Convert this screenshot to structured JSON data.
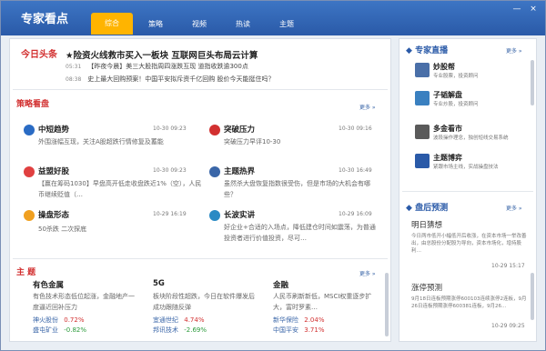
{
  "app": {
    "title": "专家看点",
    "window_buttons": [
      "—",
      "×"
    ]
  },
  "tabs": [
    {
      "label": "综合",
      "active": true
    },
    {
      "label": "策略",
      "active": false
    },
    {
      "label": "视频",
      "active": false
    },
    {
      "label": "热读",
      "active": false
    },
    {
      "label": "主题",
      "active": false
    }
  ],
  "today": {
    "label": "今日头条",
    "headline": "★险资火线救市买入一板块 互联网巨头布局云计算",
    "items": [
      {
        "time": "05:31",
        "text": "【昨夜今晨】美三大股指周四涨跌互现 道指收跌逾300点"
      },
      {
        "time": "08:38",
        "text": "史上最大回购预案！中国平安拟斥资千亿回购 股价今天能挺住吗？"
      }
    ]
  },
  "strategy": {
    "label": "策略看盘",
    "more": "更多 »",
    "items": [
      {
        "title": "中短趋势",
        "date": "10-30",
        "time": "09:23",
        "desc": "外围涨幅互现，关注A股超跌行情修复及蓄能",
        "icon_color": "#2a6bc4"
      },
      {
        "title": "突破压力",
        "date": "10-30",
        "time": "09:16",
        "desc": "突破压力早评10-30",
        "icon_color": "#d23030"
      },
      {
        "title": "益盟好股",
        "date": "10-30",
        "time": "09:23",
        "desc": "【赢在筹码1030】早盘高开低走收盘跌近1%（空），人民币继续贬值（…",
        "icon_color": "#e04040"
      },
      {
        "title": "主题热界",
        "date": "10-30",
        "time": "16:49",
        "desc": "虽然杀大盘恢复指数很受伤，但是市场的大机会有哪些？",
        "icon_color": "#3a66a8"
      },
      {
        "title": "操盘形态",
        "date": "10-29",
        "time": "16:19",
        "desc": "50杀跌 二次探底",
        "icon_color": "#f0a020"
      },
      {
        "title": "长波实讲",
        "date": "10-29",
        "time": "16:09",
        "desc": "好企业+合适的入场点，降低建仓时间如震荡，为普通投资者进行价值投资，尽可…",
        "icon_color": "#2a8ac4"
      }
    ]
  },
  "topics": {
    "label": "主 题",
    "more": "更多 »",
    "columns": [
      {
        "title": "有色金属",
        "desc": "有色技术形态低位起涨，金融地产一度逼近回补压力",
        "stocks": [
          {
            "name": "神火股份",
            "change": "0.72%",
            "dir": "up"
          },
          {
            "name": "盛屯矿业",
            "change": "-0.82%",
            "dir": "down"
          }
        ]
      },
      {
        "title": "5G",
        "desc": "板块阶段性超跌，今日在软件爆发后成功跟随反弹",
        "stocks": [
          {
            "name": "宜通世纪",
            "change": "4.74%",
            "dir": "up"
          },
          {
            "name": "邦讯技术",
            "change": "-2.69%",
            "dir": "down"
          }
        ]
      },
      {
        "title": "金融",
        "desc": "人民币刷新新低，MSCI权重逐步扩大，富时罗素…",
        "stocks": [
          {
            "name": "新华保险",
            "change": "2.04%",
            "dir": "up"
          },
          {
            "name": "中国平安",
            "change": "3.71%",
            "dir": "up"
          }
        ]
      }
    ]
  },
  "live": {
    "label": "专家直播",
    "more": "更多 »",
    "experts": [
      {
        "name": "妙股帮",
        "info": "专业股票，投资顾问",
        "color": "#4a6fa8"
      },
      {
        "name": "子韬解盘",
        "info": "专业炒股，投资顾问",
        "color": "#3a80c0"
      },
      {
        "name": "多金看市",
        "info": "波段操作理念，独创短线交易系统",
        "color": "#5a5a5a"
      },
      {
        "name": "主题博弈",
        "info": "紧跟市场主线，实战操盘技法",
        "color": "#2a5aa8"
      }
    ]
  },
  "forecast": {
    "label": "盘后预测",
    "more": "更多 »",
    "items": [
      {
        "title": "明日猜想",
        "desc": "今日两市低开小幅低开后收涨，在资本市场一举改善出，由总股份分配股为导向，资本市场化，增持股利…",
        "time": "10-29 15:17"
      },
      {
        "title": "涨停预测",
        "desc": "9月18日连板预期涨停600103连续涨停2连板，9月26日连板预期涨停600381连板，9月26…",
        "time": "10-29 09:25"
      }
    ]
  }
}
